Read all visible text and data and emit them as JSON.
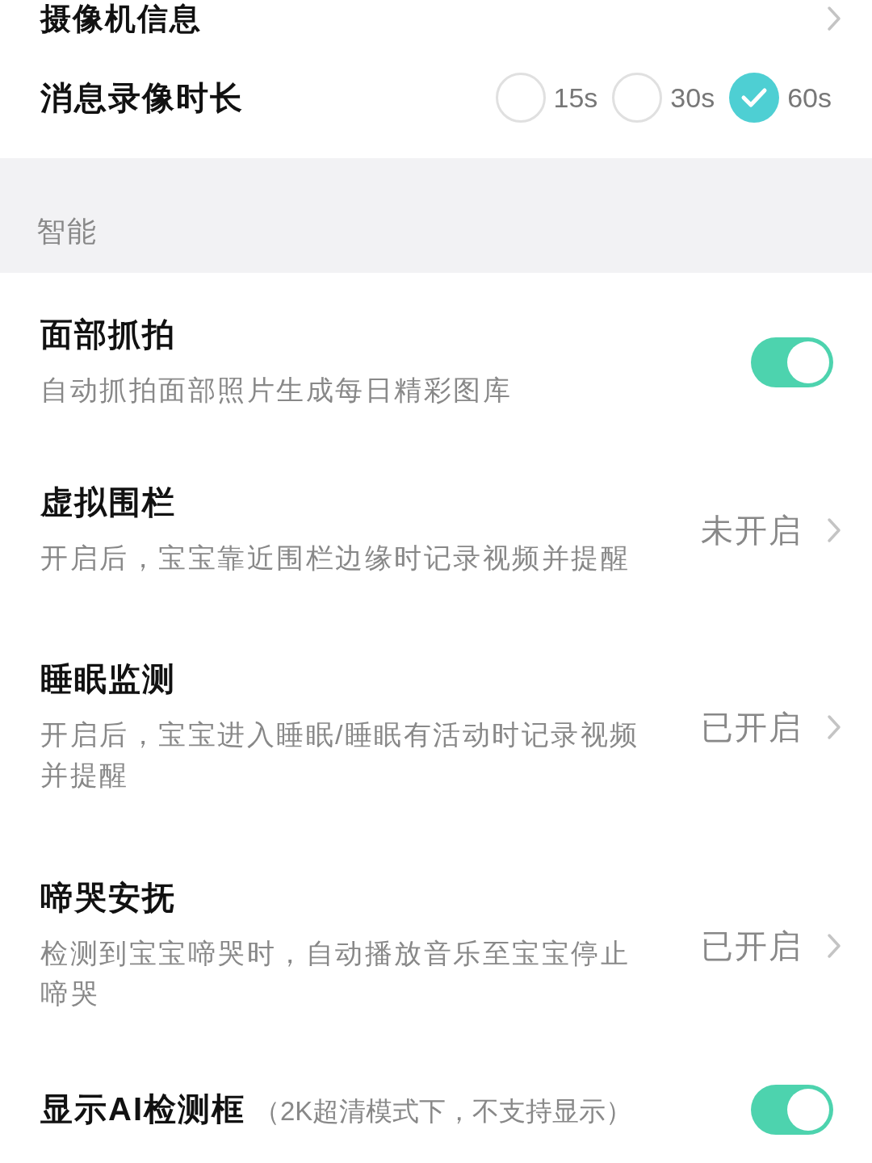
{
  "top_item": {
    "title": "摄像机信息"
  },
  "record_duration": {
    "label": "消息录像时长",
    "options": [
      {
        "label": "15s",
        "selected": false
      },
      {
        "label": "30s",
        "selected": false
      },
      {
        "label": "60s",
        "selected": true
      }
    ]
  },
  "section_header": "智能",
  "items": [
    {
      "kind": "toggle",
      "title": "面部抓拍",
      "description": "自动抓拍面部照片生成每日精彩图库",
      "on": true
    },
    {
      "kind": "link",
      "title": "虚拟围栏",
      "description": "开启后，宝宝靠近围栏边缘时记录视频并提醒",
      "value": "未开启"
    },
    {
      "kind": "link",
      "title": "睡眠监测",
      "description": "开启后，宝宝进入睡眠/睡眠有活动时记录视频并提醒",
      "value": "已开启"
    },
    {
      "kind": "link",
      "title": "啼哭安抚",
      "description": "检测到宝宝啼哭时，自动播放音乐至宝宝停止啼哭",
      "value": "已开启"
    },
    {
      "kind": "toggle",
      "title": "显示AI检测框",
      "note": "（2K超清模式下，不支持显示）",
      "on": true
    }
  ]
}
